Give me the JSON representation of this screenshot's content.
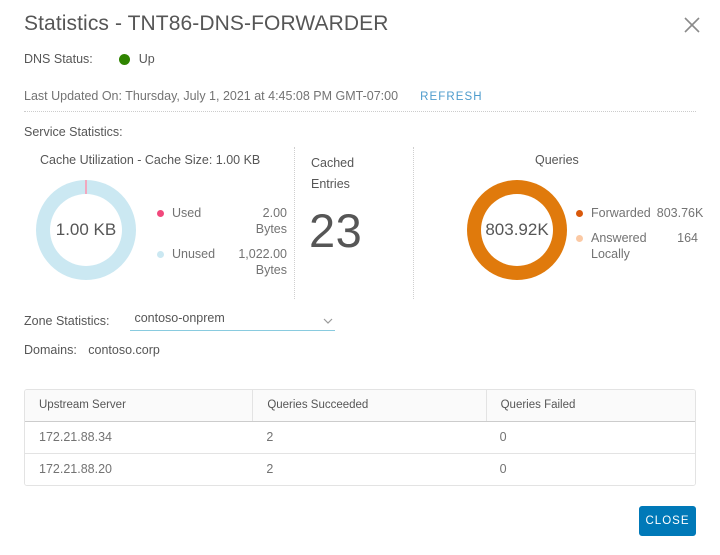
{
  "header": {
    "title": "Statistics - TNT86-DNS-FORWARDER",
    "close_icon": "close-icon"
  },
  "status": {
    "label": "DNS Status:",
    "value": "Up",
    "dot_color": "#2f8400"
  },
  "updated": {
    "text": "Last Updated On: Thursday, July 1, 2021 at 4:45:08 PM GMT-07:00",
    "refresh_label": "REFRESH"
  },
  "service_statistics": {
    "section_label": "Service Statistics:",
    "cache": {
      "title": "Cache Utilization - Cache Size: 1.00 KB",
      "center_value": "1.00 KB",
      "legend": [
        {
          "name": "Used",
          "value": "2.00 Bytes",
          "color": "#f1487c"
        },
        {
          "name": "Unused",
          "value": "1,022.00 Bytes",
          "color": "#cbe8f2"
        }
      ]
    },
    "cached_entries": {
      "title": "Cached Entries",
      "value": "23"
    },
    "queries": {
      "title": "Queries",
      "center_value": "803.92K",
      "legend": [
        {
          "name": "Forwarded",
          "value": "803.76K",
          "color": "#d9590b"
        },
        {
          "name": "Answered Locally",
          "value": "164",
          "color": "#fbc9a4"
        }
      ]
    }
  },
  "zone": {
    "label": "Zone Statistics:",
    "selected": "contoso-onprem",
    "chevron_icon": "chevron-down-icon",
    "domains_label": "Domains:",
    "domains_value": "contoso.corp"
  },
  "table": {
    "columns": [
      "Upstream Server",
      "Queries Succeeded",
      "Queries Failed"
    ],
    "rows": [
      [
        "172.21.88.34",
        "2",
        "0"
      ],
      [
        "172.21.88.20",
        "2",
        "0"
      ]
    ]
  },
  "footer": {
    "close_label": "CLOSE",
    "accent_color": "#0079b8"
  },
  "chart_data": [
    {
      "type": "pie",
      "title": "Cache Utilization - Cache Size: 1.00 KB",
      "labels": [
        "Used",
        "Unused"
      ],
      "values": [
        2,
        1022
      ],
      "value_labels": [
        "2.00 Bytes",
        "1,022.00 Bytes"
      ],
      "units": "Bytes",
      "total_label": "1.00 KB",
      "colors": [
        "#f1487c",
        "#cbe8f2"
      ],
      "legend": "right"
    },
    {
      "type": "pie",
      "title": "Queries",
      "labels": [
        "Forwarded",
        "Answered Locally"
      ],
      "values": [
        803760,
        164
      ],
      "value_labels": [
        "803.76K",
        "164"
      ],
      "total_label": "803.92K",
      "colors": [
        "#d9590b",
        "#fbc9a4"
      ],
      "legend": "right"
    },
    {
      "type": "table",
      "title": "Zone Statistics",
      "columns": [
        "Upstream Server",
        "Queries Succeeded",
        "Queries Failed"
      ],
      "rows": [
        [
          "172.21.88.34",
          2,
          0
        ],
        [
          "172.21.88.20",
          2,
          0
        ]
      ]
    }
  ]
}
